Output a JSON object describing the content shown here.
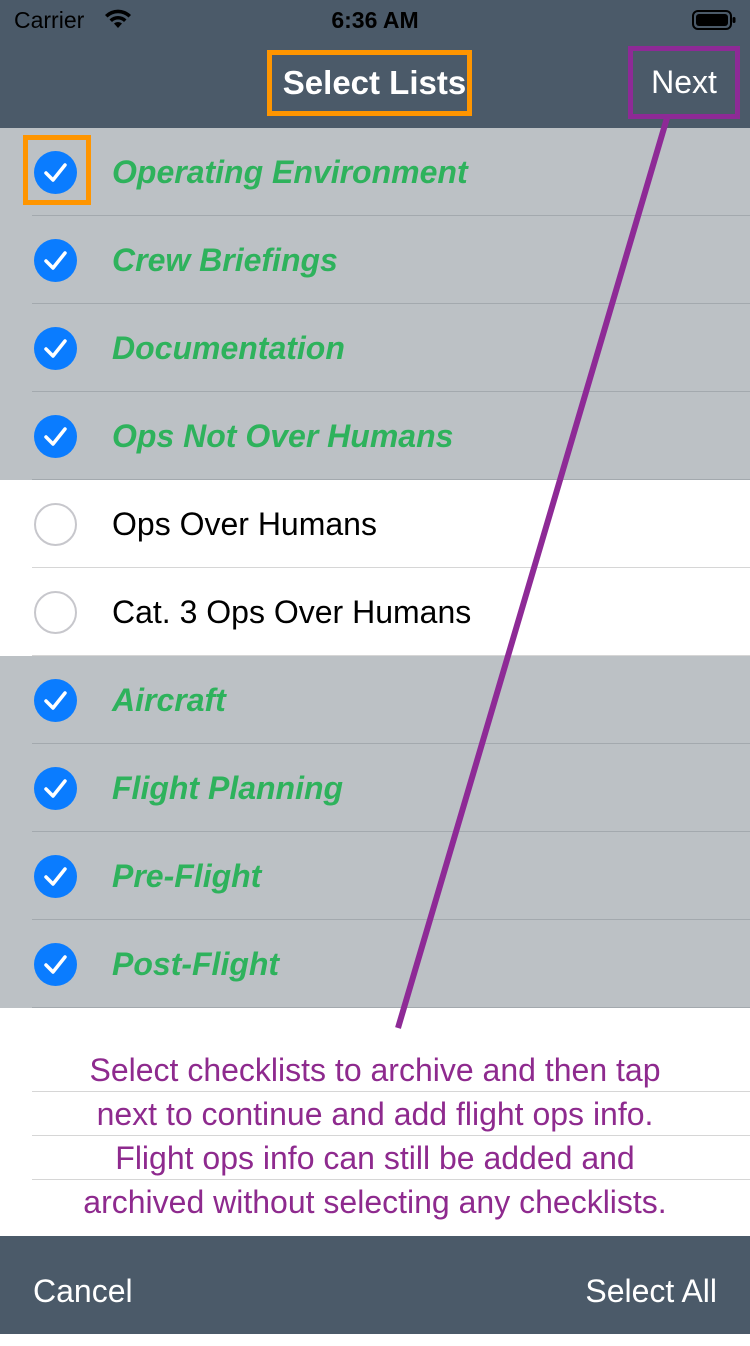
{
  "status": {
    "carrier": "Carrier",
    "time": "6:36 AM"
  },
  "nav": {
    "title": "Select Lists",
    "next_label": "Next"
  },
  "lists": [
    {
      "label": "Operating Environment",
      "selected": true
    },
    {
      "label": "Crew Briefings",
      "selected": true
    },
    {
      "label": "Documentation",
      "selected": true
    },
    {
      "label": "Ops Not Over Humans",
      "selected": true
    },
    {
      "label": "Ops Over Humans",
      "selected": false
    },
    {
      "label": "Cat. 3 Ops Over Humans",
      "selected": false
    },
    {
      "label": "Aircraft",
      "selected": true
    },
    {
      "label": "Flight Planning",
      "selected": true
    },
    {
      "label": "Pre-Flight",
      "selected": true
    },
    {
      "label": "Post-Flight",
      "selected": true
    }
  ],
  "message": {
    "lines": [
      "Select checklists to archive and then tap",
      "next to continue and add flight ops info.",
      "Flight ops info can still be added and",
      "archived without selecting any checklists."
    ]
  },
  "toolbar": {
    "cancel_label": "Cancel",
    "select_all_label": "Select All"
  },
  "colors": {
    "bar": "#4b5a69",
    "selected_row": "#bcc1c5",
    "selected_text": "#2eb25c",
    "check_blue": "#0a7cff",
    "highlight_orange": "#ff9500",
    "annotation_purple": "#8e2a96"
  },
  "icons": [
    "wifi-icon",
    "battery-icon",
    "checkmark-icon"
  ]
}
